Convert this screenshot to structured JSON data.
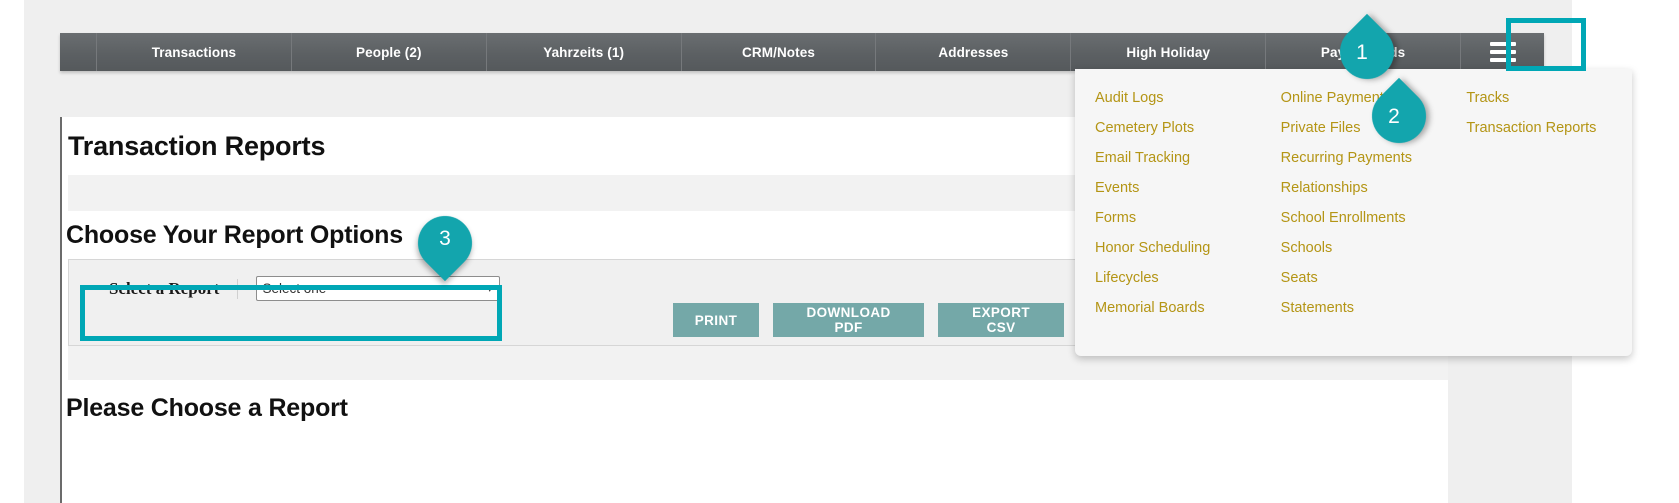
{
  "colors": {
    "accent_teal": "#13a5ad",
    "highlight_teal": "#00a7b5",
    "navbar_grey": "#5c6063",
    "menu_link_gold": "#b49515",
    "button_teal": "#74a8a8",
    "page_bg": "#efefef"
  },
  "navbar": {
    "tabs": [
      {
        "label": "Transactions"
      },
      {
        "label": "People (2)"
      },
      {
        "label": "Yahrzeits (1)"
      },
      {
        "label": "CRM/Notes"
      },
      {
        "label": "Addresses"
      },
      {
        "label": "High Holiday"
      },
      {
        "label": "Pay Methods"
      }
    ],
    "hamburger_icon": "hamburger-menu-icon"
  },
  "mega_menu": {
    "columns": [
      {
        "items": [
          {
            "label": "Audit Logs"
          },
          {
            "label": "Cemetery Plots"
          },
          {
            "label": "Email Tracking"
          },
          {
            "label": "Events"
          },
          {
            "label": "Forms"
          },
          {
            "label": "Honor Scheduling"
          },
          {
            "label": "Lifecycles"
          },
          {
            "label": "Memorial Boards"
          }
        ]
      },
      {
        "items": [
          {
            "label": "Online Payments"
          },
          {
            "label": "Private Files"
          },
          {
            "label": "Recurring Payments"
          },
          {
            "label": "Relationships"
          },
          {
            "label": "School Enrollments"
          },
          {
            "label": "Schools"
          },
          {
            "label": "Seats"
          },
          {
            "label": "Statements"
          }
        ]
      },
      {
        "items": [
          {
            "label": "Tracks"
          },
          {
            "label": "Transaction Reports"
          }
        ]
      }
    ]
  },
  "main": {
    "page_title": "Transaction Reports",
    "section_title": "Choose Your Report Options",
    "form": {
      "label": "Select a Report",
      "select_value": "Select one",
      "caret_icon": "chevron-down-icon"
    },
    "buttons": [
      {
        "label": "PRINT"
      },
      {
        "label": "DOWNLOAD PDF"
      },
      {
        "label": "EXPORT CSV"
      },
      {
        "label": ""
      },
      {
        "label": ""
      }
    ],
    "bottom_title": "Please Choose a Report"
  },
  "callouts": [
    {
      "number": "1"
    },
    {
      "number": "2"
    },
    {
      "number": "3"
    }
  ]
}
